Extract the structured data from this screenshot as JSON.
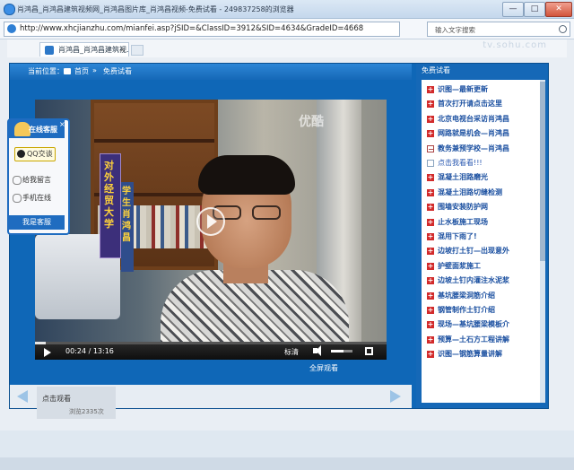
{
  "window": {
    "title": "肖鸿昌_肖鸿昌建筑视频网_肖鸿昌图片库_肖鸿昌视频-免费试看 - 249837258的浏览器",
    "minimize": "—",
    "maximize": "□",
    "close": "✕"
  },
  "address_bar": {
    "url": "http://www.xhcjianzhu.com/mianfei.asp?jSID=&ClassID=3912&SID=4634&GradeID=4668",
    "search_placeholder": "输入文字搜索"
  },
  "tab": {
    "label": "肖鸿昌_肖鸿昌建筑视...",
    "close": "×"
  },
  "watermark": "tv.sohu.com",
  "breadcrumb": {
    "position_label": "当前位置：",
    "home": "首页",
    "separator": "»",
    "current": "免费试看"
  },
  "video": {
    "sign_text": "对外经贸大学",
    "sign2_text": "学生 肖鸿昌",
    "logo": "优酷",
    "time": "00:24 / 13:16",
    "progress": 0.03,
    "volume": 0.6,
    "hd_label": "标清",
    "fullscreen_label": "全屏观看"
  },
  "bottom_strip": {
    "thumb_title": "点击观看",
    "thumb_views": "浏览2335次"
  },
  "sidebar": {
    "title": "免费试看",
    "items": [
      {
        "label": "识图—最新更新",
        "kind": "plus"
      },
      {
        "label": "首次打开请点击这里",
        "kind": "plus"
      },
      {
        "label": "北京电视台采访肖鸿昌",
        "kind": "plus"
      },
      {
        "label": "网路就是机会—肖鸿昌",
        "kind": "plus"
      },
      {
        "label": "教务兼预学校—肖鸿昌",
        "kind": "minus"
      },
      {
        "label": "点击我看看!!!",
        "kind": "sub"
      },
      {
        "label": "混凝土泪路磨光",
        "kind": "plus"
      },
      {
        "label": "混凝土泪路切缝检测",
        "kind": "plus"
      },
      {
        "label": "围墙安装防护网",
        "kind": "plus"
      },
      {
        "label": "止水板施工现场",
        "kind": "plus"
      },
      {
        "label": "混用下雨了!",
        "kind": "plus"
      },
      {
        "label": "边坡打土钉—出现意外",
        "kind": "plus"
      },
      {
        "label": "护壁面浆施工",
        "kind": "plus"
      },
      {
        "label": "边坡土钉内灌注水泥浆",
        "kind": "plus"
      },
      {
        "label": "基坑腰梁洞筋介绍",
        "kind": "plus"
      },
      {
        "label": "钢管制作土钉介绍",
        "kind": "plus"
      },
      {
        "label": "现场—基坑腰梁模板介",
        "kind": "plus"
      },
      {
        "label": "预算—土石方工程讲解",
        "kind": "plus"
      },
      {
        "label": "识图—钢筋算量讲解",
        "kind": "plus"
      }
    ]
  },
  "cs_widget": {
    "title": "在线客服",
    "close": "×",
    "qq_label": "QQ交谈",
    "message_label": "给我留言",
    "phone_label": "手机在线",
    "footer": "我是客服"
  }
}
